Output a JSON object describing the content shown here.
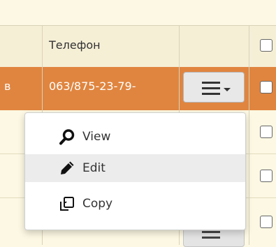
{
  "table": {
    "headers": {
      "phone": "Телефон"
    },
    "selected_row": {
      "name_fragment": "в",
      "phone": "063/875-23-79-"
    }
  },
  "row_menu": {
    "items": [
      {
        "label": "View",
        "icon": "search-icon"
      },
      {
        "label": "Edit",
        "icon": "pencil-icon",
        "active": true
      },
      {
        "label": "Copy",
        "icon": "copy-icon"
      }
    ]
  },
  "colors": {
    "row_background": "#fcf8e3",
    "selected_row": "#e0853f",
    "menu_hover": "#ececec"
  }
}
